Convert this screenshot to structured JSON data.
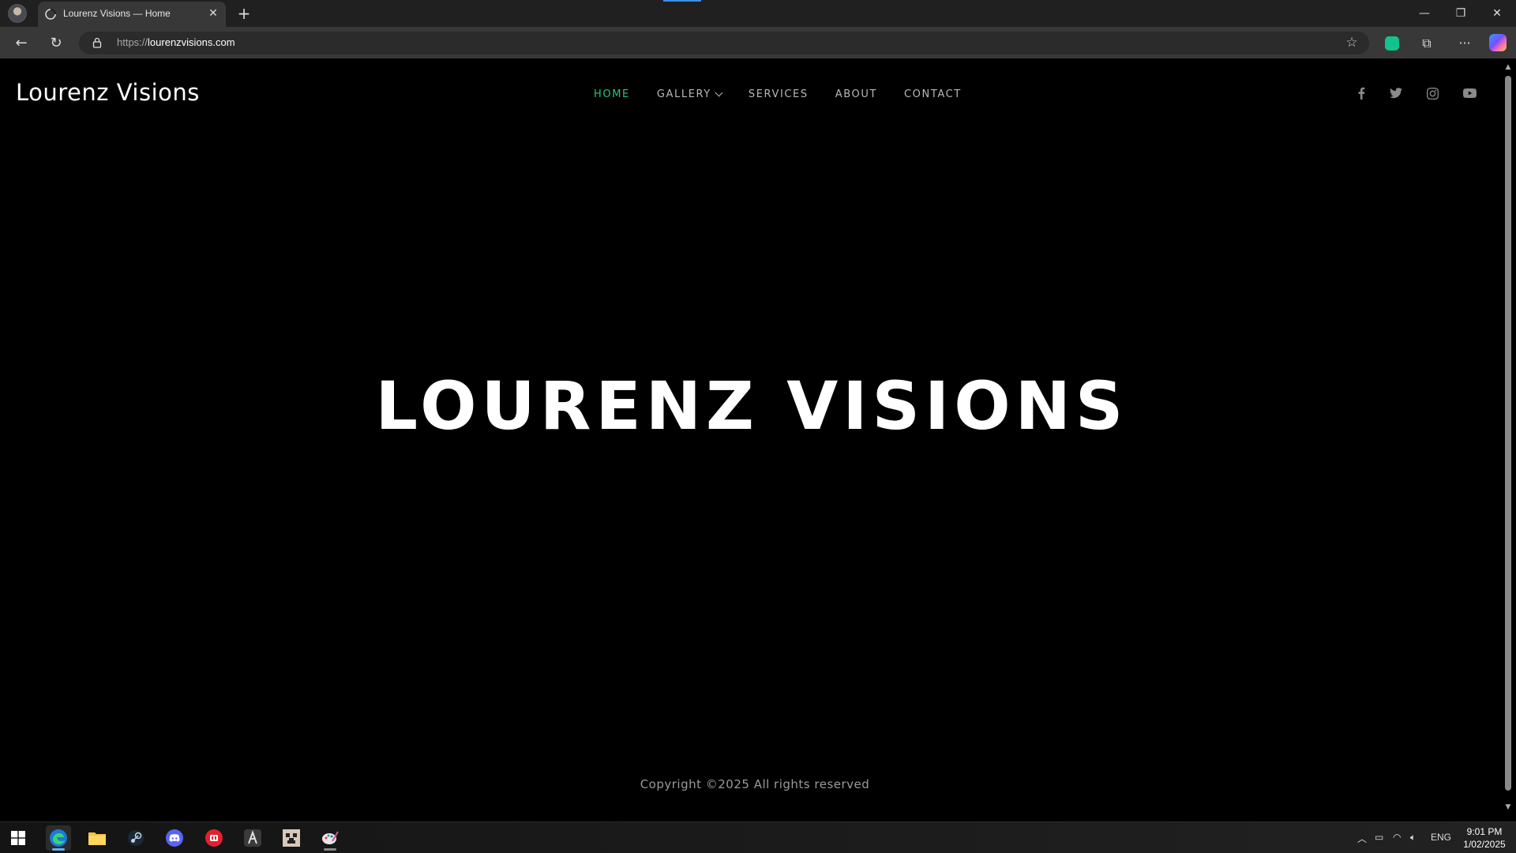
{
  "browser": {
    "tab_title": "Lourenz Visions — Home",
    "tab_close": "✕",
    "new_tab": "+",
    "url_protocol": "https://",
    "url_host": "lourenzvisions.com"
  },
  "site": {
    "logo": "Lourenz Visions",
    "nav": [
      {
        "label": "HOME",
        "active": true
      },
      {
        "label": "GALLERY",
        "dropdown": true
      },
      {
        "label": "SERVICES"
      },
      {
        "label": "ABOUT"
      },
      {
        "label": "CONTACT"
      }
    ],
    "social_icons": [
      "facebook-icon",
      "twitter-icon",
      "instagram-icon",
      "youtube-icon"
    ],
    "hero_title": "LOURENZ VISIONS",
    "copyright": "Copyright ©2025 All rights reserved",
    "accent_color": "#2ec27e"
  },
  "taskbar": {
    "apps": [
      "windows-start-icon",
      "edge-icon",
      "file-explorer-icon",
      "steam-icon",
      "discord-icon",
      "red-app-icon",
      "a-app-icon",
      "pixel-app-icon",
      "paint-app-icon"
    ],
    "language": "ENG",
    "time": "9:01 PM",
    "date": "1/02/2025"
  }
}
